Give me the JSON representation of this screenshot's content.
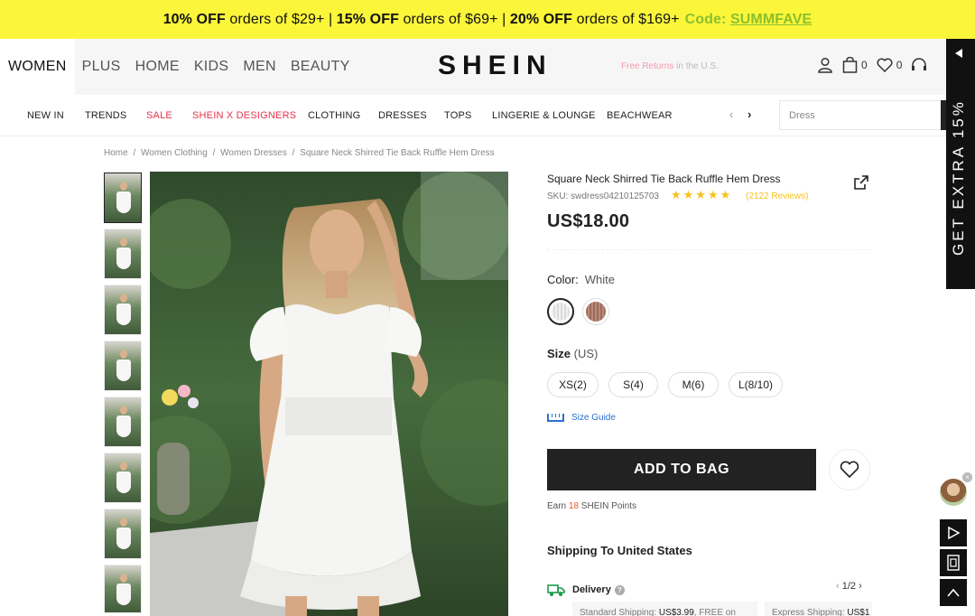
{
  "promo": {
    "p1_bold": "10% OFF",
    "p1_text": " orders of $29+ | ",
    "p2_bold": "15% OFF",
    "p2_text": " orders of $69+ | ",
    "p3_bold": "20% OFF",
    "p3_text": " orders of $169+",
    "code_label": "Code: ",
    "code_value": "SUMMFAVE"
  },
  "header": {
    "categories": [
      "WOMEN",
      "PLUS",
      "HOME",
      "KIDS",
      "MEN",
      "BEAUTY"
    ],
    "logo": "SHEIN",
    "free_returns_pink": "Free Returns",
    "free_returns_rest": " in the U.S.",
    "bag_count": "0",
    "wish_count": "0"
  },
  "subnav": {
    "items": [
      "NEW IN",
      "TRENDS",
      "SALE",
      "SHEIN X DESIGNERS",
      "CLOTHING",
      "DRESSES",
      "TOPS",
      "LINGERIE & LOUNGE",
      "BEACHWEAR"
    ],
    "prev": "‹",
    "next": "›"
  },
  "search": {
    "placeholder": "Dress"
  },
  "side_banner": {
    "text": "GET EXTRA 15%"
  },
  "breadcrumb": [
    "Home",
    "/",
    "Women Clothing",
    "/",
    "Women Dresses",
    "/",
    "Square Neck Shirred Tie Back Ruffle Hem Dress"
  ],
  "product": {
    "title": "Square Neck Shirred Tie Back Ruffle Hem Dress",
    "sku": "SKU: swdress04210125703",
    "stars": "★★★★★",
    "rating": 4.8,
    "reviews": "(2122 Reviews)",
    "price": "US$18.00",
    "color_label": "Color:",
    "color_value": "White",
    "size_label": "Size",
    "size_unit": " (US)",
    "sizes": [
      "XS(2)",
      "S(4)",
      "M(6)",
      "L(8/10)"
    ],
    "size_guide": "Size Guide",
    "add_to_bag": "ADD TO BAG",
    "earn_pre": "Earn ",
    "earn_num": "18",
    "earn_post": " SHEIN Points"
  },
  "shipping": {
    "heading": "Shipping To United States",
    "delivery_label": "Delivery",
    "pager": "1/2",
    "cards": [
      {
        "label": "Standard Shipping: ",
        "value": "US$3.99",
        "extra": ", FREE on"
      },
      {
        "label": "Express Shipping: ",
        "value": "US$1",
        "extra": ""
      }
    ]
  },
  "colors": {
    "promo_bg": "#fbf63a",
    "code": "#8cbf2c",
    "sale_red": "#e8334a",
    "star": "#f8c21c",
    "link_blue": "#2b6fd1"
  }
}
